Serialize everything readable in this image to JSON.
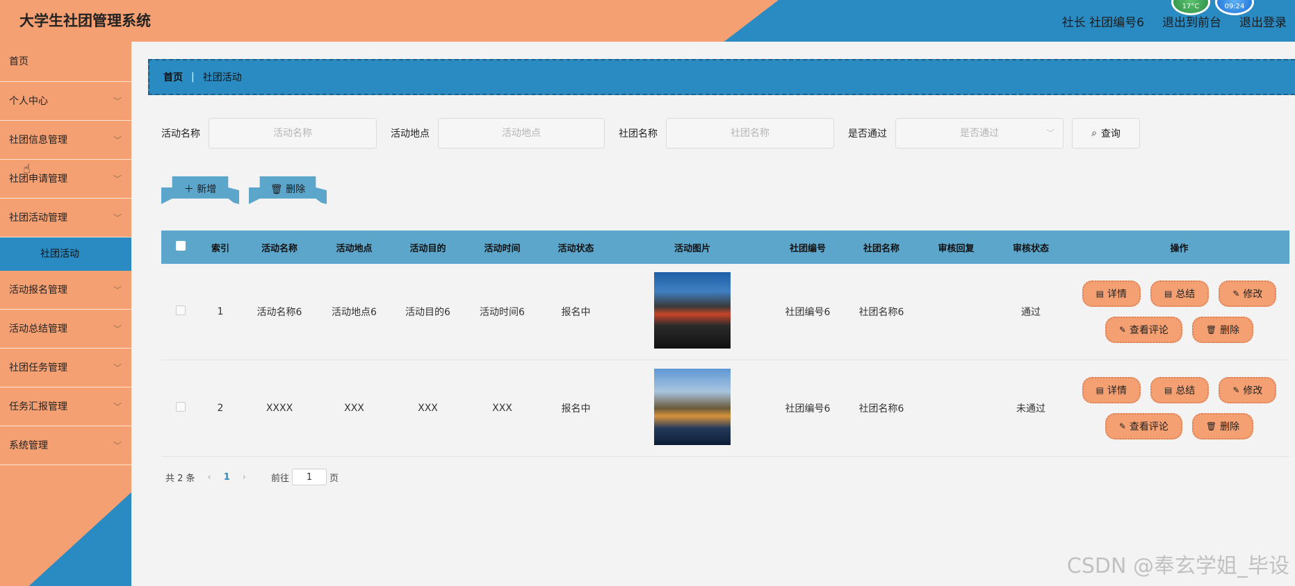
{
  "header": {
    "title": "大学生社团管理系统",
    "user_info": "社长 社团编号6",
    "front_link": "退出到前台",
    "logout": "退出登录",
    "weather_1": "17°C",
    "weather_2": "09:24"
  },
  "sidebar": {
    "items": [
      {
        "label": "首页"
      },
      {
        "label": "个人中心"
      },
      {
        "label": "社团信息管理"
      },
      {
        "label": "社团申请管理"
      },
      {
        "label": "社团活动管理"
      },
      {
        "label": "活动报名管理"
      },
      {
        "label": "活动总结管理"
      },
      {
        "label": "社团任务管理"
      },
      {
        "label": "任务汇报管理"
      },
      {
        "label": "系统管理"
      }
    ],
    "active_sub": "社团活动",
    "chevron": "chevron-down-icon"
  },
  "breadcrumb": {
    "home": "首页",
    "current": "社团活动",
    "sep": "|"
  },
  "search": {
    "name_label": "活动名称",
    "name_placeholder": "活动名称",
    "place_label": "活动地点",
    "place_placeholder": "活动地点",
    "club_label": "社团名称",
    "club_placeholder": "社团名称",
    "pass_label": "是否通过",
    "pass_placeholder": "是否通过",
    "query_button": "查询"
  },
  "actions": {
    "add": "新增",
    "delete": "删除"
  },
  "table": {
    "columns": [
      "索引",
      "活动名称",
      "活动地点",
      "活动目的",
      "活动时间",
      "活动状态",
      "活动图片",
      "社团编号",
      "社团名称",
      "审核回复",
      "审核状态",
      "操作"
    ],
    "rows": [
      {
        "index": "1",
        "name": "活动名称6",
        "place": "活动地点6",
        "purpose": "活动目的6",
        "time": "活动时间6",
        "status": "报名中",
        "club_no": "社团编号6",
        "club_name": "社团名称6",
        "reply": "",
        "audit": "通过"
      },
      {
        "index": "2",
        "name": "XXXX",
        "place": "XXX",
        "purpose": "XXX",
        "time": "XXX",
        "status": "报名中",
        "club_no": "社团编号6",
        "club_name": "社团名称6",
        "reply": "",
        "audit": "未通过"
      }
    ],
    "ops": {
      "detail": "详情",
      "summary": "总结",
      "edit": "修改",
      "comments": "查看评论",
      "delete": "删除"
    }
  },
  "pager": {
    "total": "共 2 条",
    "current": "1",
    "goto_prefix": "前往",
    "goto_value": "1",
    "goto_suffix": "页"
  },
  "watermark": "CSDN @奉玄学姐_毕设",
  "colors": {
    "orange": "#f4a072",
    "blue": "#2a8bc2",
    "header_blue": "#5da6cb"
  }
}
